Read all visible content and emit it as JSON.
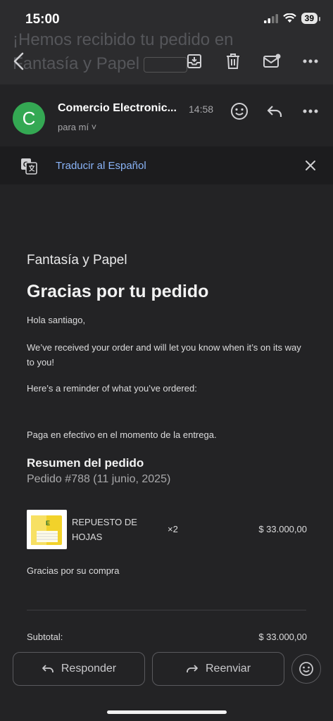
{
  "status_bar": {
    "time": "15:00",
    "battery": "39"
  },
  "header": {
    "subject_ghost_line1": "¡Hemos recibido tu pedido en",
    "subject_ghost_line2": "Fantasía y Papel"
  },
  "message": {
    "avatar_letter": "C",
    "sender": "Comercio Electronic...",
    "time": "14:58",
    "recipient": "para mí ˅"
  },
  "translate": {
    "label": "Traducir al Español"
  },
  "email": {
    "store_name": "Fantasía y Papel",
    "heading": "Gracias por tu pedido",
    "greeting": "Hola santiago,",
    "intro": "We’ve received your order and will let you know when it’s on its way to you!",
    "reminder": "Here’s a reminder of what you’ve ordered:",
    "payment_note": "Paga en efectivo en el momento de la entrega.",
    "summary_title": "Resumen del pedido",
    "order_ref": "Pedido #788 (11 junio, 2025)",
    "items": [
      {
        "name": "REPUESTO DE HOJAS",
        "qty": "×2",
        "price": "$ 33.000,00"
      }
    ],
    "thanks": "Gracias por su compra",
    "subtotal_label": "Subtotal:",
    "subtotal_value": "$ 33.000,00"
  },
  "actions": {
    "reply": "Responder",
    "forward": "Reenviar"
  },
  "colors": {
    "background": "#232325",
    "avatar": "#34a853",
    "link": "#8ab4f8"
  }
}
